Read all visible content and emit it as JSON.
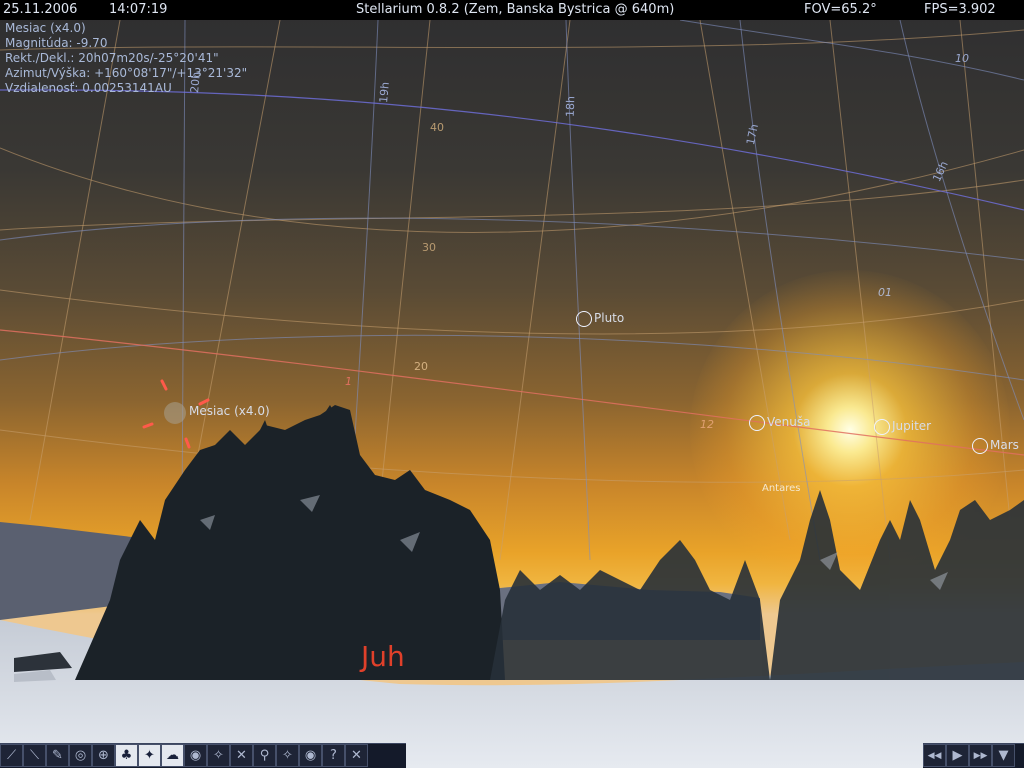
{
  "topbar": {
    "date": "25.11.2006",
    "time": "14:07:19",
    "title": "Stellarium 0.8.2 (Zem, Banska Bystrica @ 640m)",
    "fov": "FOV=65.2°",
    "fps": "FPS=3.902"
  },
  "info": {
    "name": "Mesiac (x4.0)",
    "magnitude": "Magnitúda: -9.70",
    "radec": "Rekt./Dekl.: 20h07m20s/-25°20'41\"",
    "azalt": "Azimut/Výška: +160°08'17\"/+13°21'32\"",
    "distance": "Vzdialenosť: 0.00253141AU"
  },
  "objects": {
    "pluto": "Pluto",
    "moon": "Mesiac (x4.0)",
    "venus": "Venuša",
    "jupiter": "Jupiter",
    "mars": "Mars",
    "antares": "Antares"
  },
  "grid_labels": {
    "ra_20h": "20h",
    "ra_19h": "19h",
    "ra_18h": "18h",
    "ra_17h": "17h",
    "ra_16h": "16h",
    "alt_40": "40",
    "alt_30": "30",
    "alt_20": "20",
    "ecl_1": "1",
    "ecl_12": "12",
    "ecl_10": "10",
    "ecl_01": "01"
  },
  "cardinal": "Juh",
  "toolbar_left": [
    {
      "name": "constellation-lines-icon",
      "glyph": "⟋",
      "on": false
    },
    {
      "name": "constellation-names-icon",
      "glyph": "⟍",
      "on": false
    },
    {
      "name": "constellation-art-icon",
      "glyph": "✎",
      "on": false
    },
    {
      "name": "azimuth-grid-icon",
      "glyph": "◎",
      "on": false
    },
    {
      "name": "equatorial-grid-icon",
      "glyph": "⊕",
      "on": false
    },
    {
      "name": "ground-icon",
      "glyph": "♣",
      "on": true
    },
    {
      "name": "cardinal-points-icon",
      "glyph": "✦",
      "on": true
    },
    {
      "name": "atmosphere-icon",
      "glyph": "☁",
      "on": true
    },
    {
      "name": "nebulae-icon",
      "glyph": "◉",
      "on": false
    },
    {
      "name": "planet-labels-icon",
      "glyph": "✧",
      "on": false
    },
    {
      "name": "mount-mode-icon",
      "glyph": "✕",
      "on": false
    },
    {
      "name": "search-icon",
      "glyph": "⚲",
      "on": false
    },
    {
      "name": "configuration-icon",
      "glyph": "✧",
      "on": false
    },
    {
      "name": "night-mode-icon",
      "glyph": "◉",
      "on": false
    },
    {
      "name": "help-icon",
      "glyph": "?",
      "on": false
    },
    {
      "name": "quit-icon",
      "glyph": "✕",
      "on": false
    }
  ],
  "toolbar_right": [
    {
      "name": "time-rewind-icon",
      "glyph": "◀◀"
    },
    {
      "name": "time-play-icon",
      "glyph": "▶"
    },
    {
      "name": "time-forward-icon",
      "glyph": "▶▶"
    },
    {
      "name": "time-now-icon",
      "glyph": "▼"
    }
  ],
  "colors": {
    "altaz_grid": "#c8a070",
    "equatorial_grid": "#8090c0",
    "equator": "#7070e0",
    "ecliptic": "#e07060",
    "cardinal": "#e0402a"
  }
}
